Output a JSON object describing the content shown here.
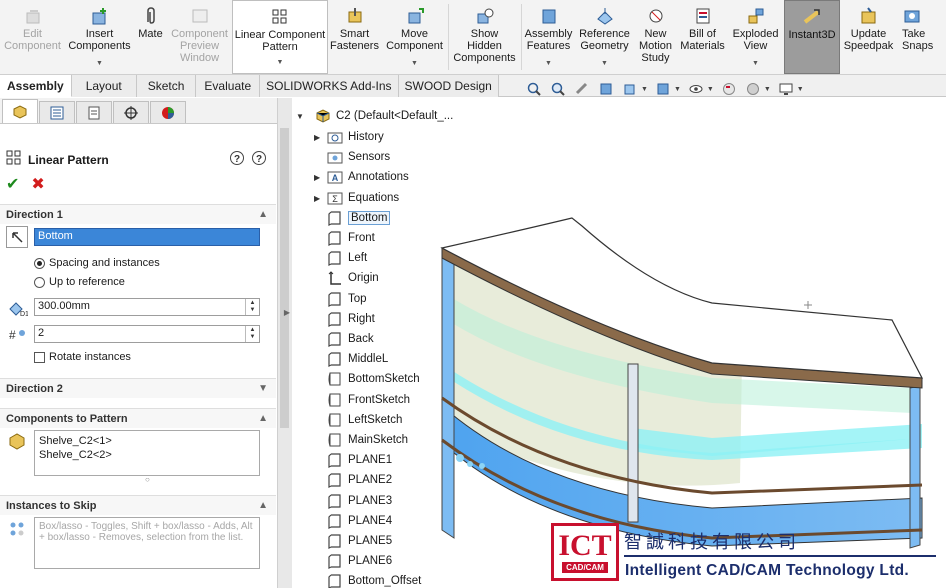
{
  "ribbon": {
    "items": [
      {
        "label": "Edit\nComponent",
        "icon": "edit-component-icon",
        "disabled": true
      },
      {
        "label": "Insert\nComponents",
        "icon": "insert-components-icon"
      },
      {
        "label": "Mate",
        "icon": "mate-paperclip-icon"
      },
      {
        "label": "Component\nPreview\nWindow",
        "icon": "component-preview-icon",
        "disabled": true
      },
      {
        "label": "Linear Component\nPattern",
        "icon": "linear-pattern-icon",
        "boxed": true
      },
      {
        "label": "Smart\nFasteners",
        "icon": "smart-fasteners-icon"
      },
      {
        "label": "Move\nComponent",
        "icon": "move-component-icon"
      },
      {
        "label": "Show\nHidden\nComponents",
        "icon": "show-hidden-icon"
      },
      {
        "label": "Assembly\nFeatures",
        "icon": "assembly-features-icon"
      },
      {
        "label": "Reference\nGeometry",
        "icon": "reference-geometry-icon"
      },
      {
        "label": "New\nMotion\nStudy",
        "icon": "motion-study-icon"
      },
      {
        "label": "Bill of\nMaterials",
        "icon": "bom-icon"
      },
      {
        "label": "Exploded\nView",
        "icon": "exploded-view-icon"
      },
      {
        "label": "Instant3D",
        "icon": "instant3d-icon",
        "active": true
      },
      {
        "label": "Update\nSpeedpak",
        "icon": "speedpak-icon"
      },
      {
        "label": "Take\nSnapsh",
        "icon": "snapshot-icon"
      }
    ]
  },
  "tabs": [
    "Assembly",
    "Layout",
    "Sketch",
    "Evaluate",
    "SOLIDWORKS Add-Ins",
    "SWOOD Design"
  ],
  "property_manager": {
    "title": "Linear Pattern",
    "direction1": {
      "header": "Direction 1",
      "reference": "Bottom",
      "option_spacing": "Spacing and instances",
      "option_reference": "Up to reference",
      "spacing": "300.00mm",
      "instances": "2",
      "rotate_label": "Rotate instances"
    },
    "direction2": {
      "header": "Direction 2"
    },
    "components": {
      "header": "Components to Pattern",
      "items": [
        "Shelve_C2<1>",
        "Shelve_C2<2>"
      ]
    },
    "skip": {
      "header": "Instances to Skip",
      "hint": "Box/lasso - Toggles, Shift + box/lasso - Adds, Alt + box/lasso - Removes, selection from the list."
    }
  },
  "tree": {
    "root": "C2  (Default<Default_...",
    "items": [
      {
        "label": "History",
        "icon": "history-folder-icon",
        "toggle": true
      },
      {
        "label": "Sensors",
        "icon": "sensors-icon",
        "toggle": false
      },
      {
        "label": "Annotations",
        "icon": "annotations-icon",
        "toggle": true
      },
      {
        "label": "Equations",
        "icon": "equations-icon",
        "toggle": true
      },
      {
        "label": "Bottom",
        "icon": "plane-icon",
        "selected": true
      },
      {
        "label": "Front",
        "icon": "plane-icon"
      },
      {
        "label": "Left",
        "icon": "plane-icon"
      },
      {
        "label": "Origin",
        "icon": "origin-icon"
      },
      {
        "label": "Top",
        "icon": "plane-icon"
      },
      {
        "label": "Right",
        "icon": "plane-icon"
      },
      {
        "label": "Back",
        "icon": "plane-icon"
      },
      {
        "label": "MiddleL",
        "icon": "plane-icon"
      },
      {
        "label": "BottomSketch",
        "icon": "sketch-icon"
      },
      {
        "label": "FrontSketch",
        "icon": "sketch-icon"
      },
      {
        "label": "LeftSketch",
        "icon": "sketch-icon"
      },
      {
        "label": "MainSketch",
        "icon": "sketch-icon"
      },
      {
        "label": "PLANE1",
        "icon": "plane-icon"
      },
      {
        "label": "PLANE2",
        "icon": "plane-icon"
      },
      {
        "label": "PLANE3",
        "icon": "plane-icon"
      },
      {
        "label": "PLANE4",
        "icon": "plane-icon"
      },
      {
        "label": "PLANE5",
        "icon": "plane-icon"
      },
      {
        "label": "PLANE6",
        "icon": "plane-icon"
      },
      {
        "label": "Bottom_Offset",
        "icon": "plane-icon"
      }
    ]
  },
  "branding": {
    "logo_text": "ICT",
    "logo_sub": "CAD/CAM",
    "chinese_name": "智誠科技有限公司",
    "english_name": "Intelligent CAD/CAM Technology Ltd."
  },
  "colors": {
    "accent_selection": "#3b86d8",
    "ok_green": "#1e8a1e",
    "cancel_red": "#d21c1c",
    "brand_red": "#c8102e",
    "brand_navy": "#1c2e6c"
  }
}
